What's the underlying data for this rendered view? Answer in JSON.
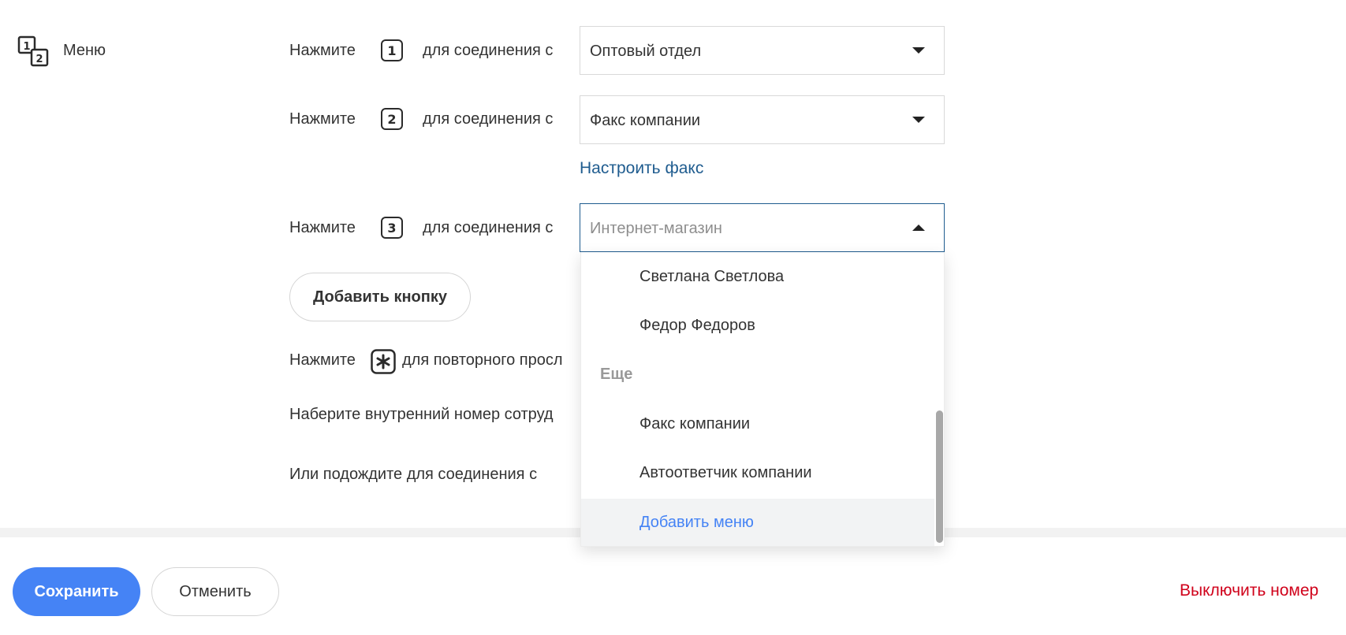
{
  "section": {
    "icon": "numbered-menu-icon",
    "label": "Меню",
    "icon_digits": [
      "1",
      "2"
    ]
  },
  "rows": [
    {
      "press": "Нажмите",
      "key": "1",
      "connect": "для соединения с",
      "value": "Оптовый отдел"
    },
    {
      "press": "Нажмите",
      "key": "2",
      "connect": "для соединения с",
      "value": "Факс компании"
    },
    {
      "press": "Нажмите",
      "key": "3",
      "connect": "для соединения с",
      "value": "Интернет-магазин"
    }
  ],
  "configure_fax_link": "Настроить факс",
  "add_button_label": "Добавить кнопку",
  "repeat": {
    "prefix": "Нажмите",
    "key_icon": "asterisk-key-icon",
    "text": "для повторного просл"
  },
  "extension_text": "Наберите внутренний номер сотруд",
  "wait_text": "Или подождите для соединения с",
  "dropdown": {
    "items": [
      {
        "label": "Светлана Светлова"
      },
      {
        "label": "Федор Федоров"
      }
    ],
    "group_label": "Еще",
    "group_items": [
      {
        "label": "Факс компании"
      },
      {
        "label": "Автоответчик компании"
      },
      {
        "label": "Добавить меню"
      }
    ]
  },
  "footer": {
    "save_label": "Сохранить",
    "cancel_label": "Отменить",
    "disable_label": "Выключить номер"
  },
  "colors": {
    "accent": "#4583f5",
    "link": "#1f5c8f",
    "danger": "#d0021b",
    "text": "#333333"
  }
}
